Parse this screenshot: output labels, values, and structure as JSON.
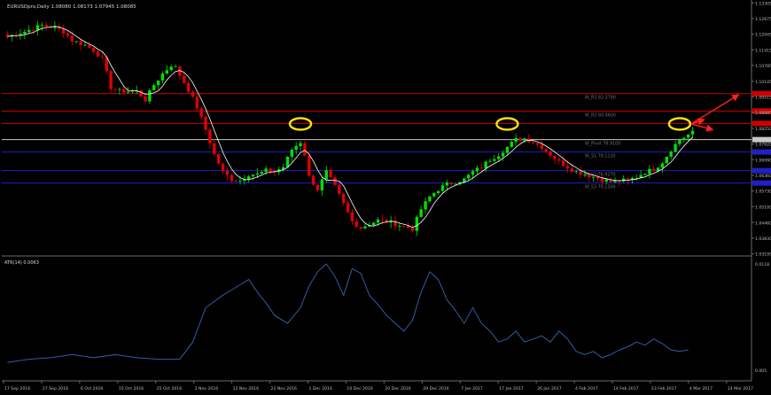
{
  "header": {
    "symbol_label": "EURUSDpro,Daily",
    "ohlc": "1.08080 1.08173 1.07945 1.08085"
  },
  "indicator_label": "ATR(14) 0.0063",
  "colors": {
    "background": "#000000",
    "grid": "#1f1f1f",
    "bull": "#00e000",
    "bear": "#e00000",
    "ma": "#ffffff",
    "level_red": "#cc0000",
    "level_blue": "#2020c8",
    "pivot": "#c8c8c8",
    "atr": "#2f5f9e",
    "circle": "#ffe600",
    "arrow": "#ff2020",
    "axis_text": "#bfbfbf",
    "level_text": "#6f6f6f"
  },
  "chart_data": [
    {
      "type": "candlestick",
      "price_axis": {
        "ylim": [
          1.0315,
          1.1335
        ],
        "ticks": [
          "1.13305",
          "1.12675",
          "1.12045",
          "1.11415",
          "1.10785",
          "1.10145",
          "1.09515",
          "1.08885",
          "1.08250",
          "1.07620",
          "1.06990",
          "1.06360",
          "1.05730",
          "1.05100",
          "1.04460",
          "1.03830",
          "1.03195"
        ]
      },
      "x_axis_labels": [
        "17 Sep 2016",
        "27 Sep 2016",
        "6 Oct 2016",
        "15 Oct 2016",
        "25 Oct 2016",
        "3 Nov 2016",
        "12 Nov 2016",
        "22 Nov 2016",
        "1 Dec 2016",
        "10 Dec 2016",
        "20 Dec 2016",
        "29 Dec 2016",
        "7 Jan 2017",
        "17 Jan 2017",
        "26 Jan 2017",
        "4 Feb 2017",
        "14 Feb 2017",
        "23 Feb 2017",
        "4 Mar 2017",
        "14 Mar 2017"
      ],
      "close_path": [
        [
          0,
          1.1195
        ],
        [
          4,
          1.1215
        ],
        [
          8,
          1.124
        ],
        [
          11,
          1.123
        ],
        [
          13,
          1.1215
        ],
        [
          15,
          1.118
        ],
        [
          18,
          1.116
        ],
        [
          20,
          1.114
        ],
        [
          22,
          1.1105
        ],
        [
          24,
          1.099
        ],
        [
          26,
          1.0975
        ],
        [
          28,
          1.0975
        ],
        [
          30,
          1.0975
        ],
        [
          32,
          1.094
        ],
        [
          34,
          1.1
        ],
        [
          36,
          1.1045
        ],
        [
          38,
          1.108
        ],
        [
          39,
          1.107
        ],
        [
          40,
          1.104
        ],
        [
          42,
          1.098
        ],
        [
          44,
          1.091
        ],
        [
          46,
          1.082
        ],
        [
          48,
          1.072
        ],
        [
          50,
          1.065
        ],
        [
          52,
          1.062
        ],
        [
          54,
          1.0615
        ],
        [
          56,
          1.064
        ],
        [
          58,
          1.064
        ],
        [
          60,
          1.0655
        ],
        [
          62,
          1.065
        ],
        [
          64,
          1.067
        ],
        [
          66,
          1.074
        ],
        [
          68,
          1.077
        ],
        [
          69,
          1.072
        ],
        [
          70,
          1.063
        ],
        [
          72,
          1.058
        ],
        [
          74,
          1.065
        ],
        [
          76,
          1.059
        ],
        [
          78,
          1.052
        ],
        [
          80,
          1.045
        ],
        [
          82,
          1.0425
        ],
        [
          84,
          1.044
        ],
        [
          86,
          1.0455
        ],
        [
          88,
          1.045
        ],
        [
          90,
          1.044
        ],
        [
          92,
          1.043
        ],
        [
          94,
          1.042
        ],
        [
          96,
          1.05
        ],
        [
          98,
          1.055
        ],
        [
          100,
          1.058
        ],
        [
          102,
          1.06
        ],
        [
          104,
          1.061
        ],
        [
          106,
          1.062
        ],
        [
          108,
          1.065
        ],
        [
          110,
          1.067
        ],
        [
          112,
          1.07
        ],
        [
          114,
          1.072
        ],
        [
          116,
          1.075
        ],
        [
          118,
          1.078
        ],
        [
          120,
          1.0785
        ],
        [
          122,
          1.077
        ],
        [
          124,
          1.075
        ],
        [
          126,
          1.072
        ],
        [
          128,
          1.069
        ],
        [
          130,
          1.067
        ],
        [
          132,
          1.065
        ],
        [
          134,
          1.064
        ],
        [
          136,
          1.063
        ],
        [
          138,
          1.062
        ],
        [
          140,
          1.061
        ],
        [
          142,
          1.0615
        ],
        [
          144,
          1.0615
        ],
        [
          146,
          1.063
        ],
        [
          148,
          1.065
        ],
        [
          150,
          1.066
        ],
        [
          152,
          1.069
        ],
        [
          154,
          1.074
        ],
        [
          156,
          1.078
        ],
        [
          158,
          1.08
        ],
        [
          159,
          1.0808
        ]
      ],
      "bar_count": 160,
      "levels": [
        {
          "name": "W_R3",
          "label": "W_R3 82.3790",
          "value": 1.0965,
          "color_key": "level_red"
        },
        {
          "name": "W_R2",
          "label": "W_R2 80.4600",
          "value": 1.0895,
          "color_key": "level_red"
        },
        {
          "name": "W_R1",
          "label": "",
          "value": 1.0845,
          "color_key": "level_red"
        },
        {
          "name": "W_Pivot",
          "label": "W_Pivot 78.9100",
          "value": 1.078,
          "color_key": "pivot"
        },
        {
          "name": "W_S1",
          "label": "W_S1 78.1130",
          "value": 1.073,
          "color_key": "level_blue"
        },
        {
          "name": "W_S2",
          "label": "W_S2 76.9270",
          "value": 1.0655,
          "color_key": "level_blue"
        },
        {
          "name": "W_S3",
          "label": "W_S3 76.1300",
          "value": 1.0605,
          "color_key": "level_blue"
        }
      ],
      "circle_marks": [
        {
          "bar": 68,
          "price": 1.0843
        },
        {
          "bar": 116,
          "price": 1.0843
        },
        {
          "bar": 156,
          "price": 1.0843
        }
      ],
      "arrow_marks": [
        {
          "from_bar": 157,
          "from_price": 1.0843,
          "to_bar": 168,
          "to_price": 1.096
        },
        {
          "from_bar": 157,
          "from_price": 1.0843,
          "to_bar": 160,
          "to_price": 1.086
        },
        {
          "from_bar": 157,
          "from_price": 1.0843,
          "to_bar": 162,
          "to_price": 1.082
        }
      ]
    },
    {
      "type": "line",
      "name": "ATR(14)",
      "value": "0.0063",
      "axis": {
        "ylim": [
          0.005,
          0.0118
        ],
        "ticks": [
          "0.0118",
          "0.005"
        ]
      },
      "points": [
        [
          0,
          0.0055
        ],
        [
          5,
          0.0057
        ],
        [
          10,
          0.0058
        ],
        [
          15,
          0.006
        ],
        [
          20,
          0.0058
        ],
        [
          25,
          0.006
        ],
        [
          30,
          0.0058
        ],
        [
          35,
          0.0057
        ],
        [
          40,
          0.0057
        ],
        [
          43,
          0.0068
        ],
        [
          46,
          0.009
        ],
        [
          50,
          0.0098
        ],
        [
          53,
          0.0103
        ],
        [
          56,
          0.0108
        ],
        [
          58,
          0.01
        ],
        [
          60,
          0.0093
        ],
        [
          62,
          0.0085
        ],
        [
          65,
          0.008
        ],
        [
          68,
          0.009
        ],
        [
          70,
          0.0104
        ],
        [
          72,
          0.0113
        ],
        [
          74,
          0.0118
        ],
        [
          76,
          0.011
        ],
        [
          78,
          0.0098
        ],
        [
          80,
          0.0115
        ],
        [
          82,
          0.0112
        ],
        [
          84,
          0.0098
        ],
        [
          86,
          0.0092
        ],
        [
          88,
          0.0085
        ],
        [
          90,
          0.008
        ],
        [
          92,
          0.0075
        ],
        [
          94,
          0.0082
        ],
        [
          96,
          0.01
        ],
        [
          98,
          0.0113
        ],
        [
          100,
          0.0108
        ],
        [
          102,
          0.0095
        ],
        [
          104,
          0.0088
        ],
        [
          106,
          0.008
        ],
        [
          108,
          0.009
        ],
        [
          110,
          0.008
        ],
        [
          112,
          0.0075
        ],
        [
          114,
          0.0068
        ],
        [
          116,
          0.007
        ],
        [
          118,
          0.0075
        ],
        [
          120,
          0.0068
        ],
        [
          122,
          0.007
        ],
        [
          124,
          0.0072
        ],
        [
          126,
          0.0068
        ],
        [
          128,
          0.0075
        ],
        [
          130,
          0.007
        ],
        [
          132,
          0.0062
        ],
        [
          134,
          0.006
        ],
        [
          136,
          0.0062
        ],
        [
          138,
          0.0058
        ],
        [
          140,
          0.006
        ],
        [
          142,
          0.0063
        ],
        [
          144,
          0.0065
        ],
        [
          146,
          0.0068
        ],
        [
          148,
          0.0066
        ],
        [
          150,
          0.007
        ],
        [
          152,
          0.0067
        ],
        [
          154,
          0.0063
        ],
        [
          156,
          0.0062
        ],
        [
          158,
          0.0063
        ]
      ]
    }
  ]
}
